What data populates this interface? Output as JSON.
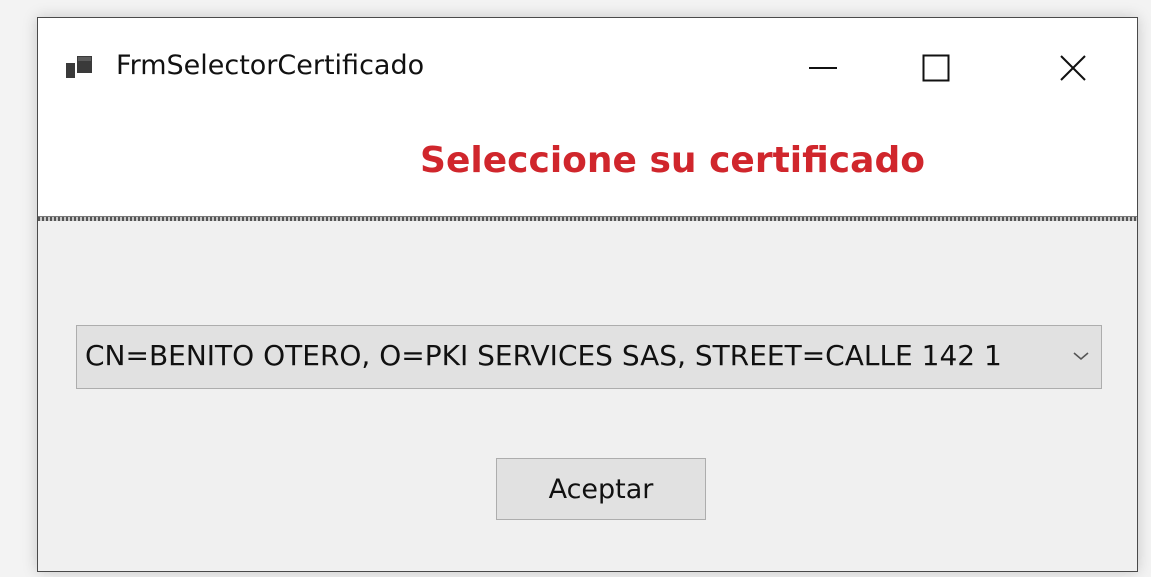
{
  "window": {
    "title": "FrmSelectorCertificado",
    "controls": {
      "minimize": "minimize-icon",
      "maximize": "maximize-icon",
      "close": "close-icon"
    }
  },
  "header": {
    "heading": "Seleccione su certificado",
    "heading_color": "#d0262c"
  },
  "certificate_select": {
    "selected_value": "CN=BENITO OTERO, O=PKI SERVICES SAS, STREET=CALLE 142 1",
    "arrow_icon": "chevron-down-icon"
  },
  "actions": {
    "accept_label": "Aceptar"
  }
}
